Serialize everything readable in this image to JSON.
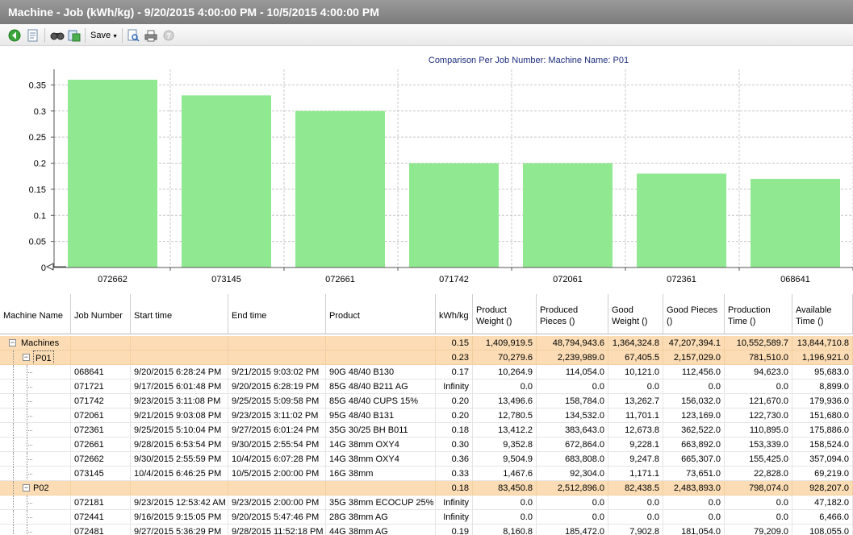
{
  "window": {
    "title": "Machine - Job (kWh/kg) - 9/20/2015 4:00:00 PM - 10/5/2015 4:00:00 PM"
  },
  "toolbar": {
    "save_label": "Save",
    "icons": [
      "back-icon",
      "document-icon",
      "find-icon",
      "export-icon",
      "save-menu",
      "print-preview-icon",
      "print-icon",
      "help-icon"
    ]
  },
  "chart_data": {
    "type": "bar",
    "title": "Comparison Per Job Number: Machine Name: P01",
    "categories": [
      "072662",
      "073145",
      "072661",
      "071742",
      "072061",
      "072361",
      "068641"
    ],
    "values": [
      0.36,
      0.33,
      0.3,
      0.2,
      0.2,
      0.18,
      0.17
    ],
    "ylim": [
      0,
      0.38
    ],
    "yticks": [
      "0",
      "0.05",
      "0.1",
      "0.15",
      "0.2",
      "0.25",
      "0.3",
      "0.35"
    ],
    "xlabel": "",
    "ylabel": "",
    "grid": true,
    "bar_color": "#90e891"
  },
  "table": {
    "columns": [
      "Machine Name",
      "Job Number",
      "Start time",
      "End time",
      "Product",
      "kWh/kg",
      "Product Weight ()",
      "Produced Pieces ()",
      "Good Weight ()",
      "Good Pieces ()",
      "Production Time ()",
      "Available Time ()"
    ],
    "rows": [
      {
        "level": 0,
        "group": true,
        "name": "Machines",
        "job": "",
        "start": "",
        "end": "",
        "product": "",
        "kwh": "0.15",
        "pweight": "1,409,919.5",
        "ppieces": "48,794,943.6",
        "gweight": "1,364,324.8",
        "gpieces": "47,207,394.1",
        "ptime": "10,552,589.7",
        "atime": "13,844,710.8"
      },
      {
        "level": 1,
        "group": true,
        "name": "P01",
        "job": "",
        "start": "",
        "end": "",
        "product": "",
        "kwh": "0.23",
        "pweight": "70,279.6",
        "ppieces": "2,239,989.0",
        "gweight": "67,405.5",
        "gpieces": "2,157,029.0",
        "ptime": "781,510.0",
        "atime": "1,196,921.0"
      },
      {
        "level": 2,
        "group": false,
        "name": "",
        "job": "068641",
        "start": "9/20/2015 6:28:24 PM",
        "end": "9/21/2015 9:03:02 PM",
        "product": "90G 48/40 B130",
        "kwh": "0.17",
        "pweight": "10,264.9",
        "ppieces": "114,054.0",
        "gweight": "10,121.0",
        "gpieces": "112,456.0",
        "ptime": "94,623.0",
        "atime": "95,683.0"
      },
      {
        "level": 2,
        "group": false,
        "name": "",
        "job": "071721",
        "start": "9/17/2015 6:01:48 PM",
        "end": "9/20/2015 6:28:19 PM",
        "product": "85G 48/40 B211 AG",
        "kwh": "Infinity",
        "pweight": "0.0",
        "ppieces": "0.0",
        "gweight": "0.0",
        "gpieces": "0.0",
        "ptime": "0.0",
        "atime": "8,899.0"
      },
      {
        "level": 2,
        "group": false,
        "name": "",
        "job": "071742",
        "start": "9/23/2015 3:11:08 PM",
        "end": "9/25/2015 5:09:58 PM",
        "product": "85G 48/40 CUPS 15%",
        "kwh": "0.20",
        "pweight": "13,496.6",
        "ppieces": "158,784.0",
        "gweight": "13,262.7",
        "gpieces": "156,032.0",
        "ptime": "121,670.0",
        "atime": "179,936.0"
      },
      {
        "level": 2,
        "group": false,
        "name": "",
        "job": "072061",
        "start": "9/21/2015 9:03:08 PM",
        "end": "9/23/2015 3:11:02 PM",
        "product": "95G 48/40 B131",
        "kwh": "0.20",
        "pweight": "12,780.5",
        "ppieces": "134,532.0",
        "gweight": "11,701.1",
        "gpieces": "123,169.0",
        "ptime": "122,730.0",
        "atime": "151,680.0"
      },
      {
        "level": 2,
        "group": false,
        "name": "",
        "job": "072361",
        "start": "9/25/2015 5:10:04 PM",
        "end": "9/27/2015 6:01:24 PM",
        "product": "35G 30/25 BH  B011",
        "kwh": "0.18",
        "pweight": "13,412.2",
        "ppieces": "383,643.0",
        "gweight": "12,673.8",
        "gpieces": "362,522.0",
        "ptime": "110,895.0",
        "atime": "175,886.0"
      },
      {
        "level": 2,
        "group": false,
        "name": "",
        "job": "072661",
        "start": "9/28/2015 6:53:54 PM",
        "end": "9/30/2015 2:55:54 PM",
        "product": "14G 38mm OXY4",
        "kwh": "0.30",
        "pweight": "9,352.8",
        "ppieces": "672,864.0",
        "gweight": "9,228.1",
        "gpieces": "663,892.0",
        "ptime": "153,339.0",
        "atime": "158,524.0"
      },
      {
        "level": 2,
        "group": false,
        "name": "",
        "job": "072662",
        "start": "9/30/2015 2:55:59 PM",
        "end": "10/4/2015 6:07:28 PM",
        "product": "14G 38mm OXY4",
        "kwh": "0.36",
        "pweight": "9,504.9",
        "ppieces": "683,808.0",
        "gweight": "9,247.8",
        "gpieces": "665,307.0",
        "ptime": "155,425.0",
        "atime": "357,094.0"
      },
      {
        "level": 2,
        "group": false,
        "name": "",
        "job": "073145",
        "start": "10/4/2015 6:46:25 PM",
        "end": "10/5/2015 2:00:00 PM",
        "product": "16G 38mm",
        "kwh": "0.33",
        "pweight": "1,467.6",
        "ppieces": "92,304.0",
        "gweight": "1,171.1",
        "gpieces": "73,651.0",
        "ptime": "22,828.0",
        "atime": "69,219.0"
      },
      {
        "level": 1,
        "group": true,
        "name": "P02",
        "job": "",
        "start": "",
        "end": "",
        "product": "",
        "kwh": "0.18",
        "pweight": "83,450.8",
        "ppieces": "2,512,896.0",
        "gweight": "82,438.5",
        "gpieces": "2,483,893.0",
        "ptime": "798,074.0",
        "atime": "928,207.0"
      },
      {
        "level": 2,
        "group": false,
        "name": "",
        "job": "072181",
        "start": "9/23/2015 12:53:42 AM",
        "end": "9/23/2015 2:00:00 PM",
        "product": "35G 38mm ECOCUP 25%",
        "kwh": "Infinity",
        "pweight": "0.0",
        "ppieces": "0.0",
        "gweight": "0.0",
        "gpieces": "0.0",
        "ptime": "0.0",
        "atime": "47,182.0"
      },
      {
        "level": 2,
        "group": false,
        "name": "",
        "job": "072441",
        "start": "9/16/2015 9:15:05 PM",
        "end": "9/20/2015 5:47:46 PM",
        "product": "28G 38mm AG",
        "kwh": "Infinity",
        "pweight": "0.0",
        "ppieces": "0.0",
        "gweight": "0.0",
        "gpieces": "0.0",
        "ptime": "0.0",
        "atime": "6,466.0"
      },
      {
        "level": 2,
        "group": false,
        "name": "",
        "job": "072481",
        "start": "9/27/2015 5:36:29 PM",
        "end": "9/28/2015 11:52:18 PM",
        "product": "44G 38mm AG",
        "kwh": "0.19",
        "pweight": "8,160.8",
        "ppieces": "185,472.0",
        "gweight": "7,902.8",
        "gpieces": "181,054.0",
        "ptime": "79,209.0",
        "atime": "108,055.0"
      }
    ]
  }
}
